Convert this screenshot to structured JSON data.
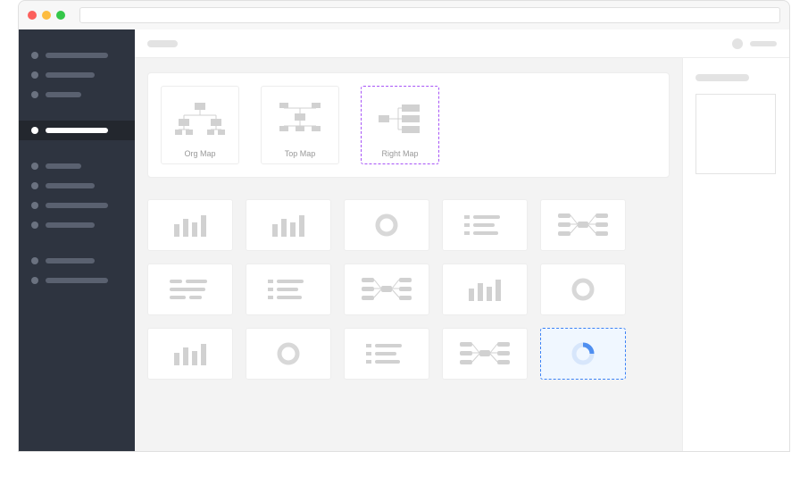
{
  "maps": [
    {
      "label": "Org  Map",
      "selected": false,
      "kind": "org"
    },
    {
      "label": "Top Map",
      "selected": false,
      "kind": "top"
    },
    {
      "label": "Right Map",
      "selected": true,
      "kind": "right"
    }
  ],
  "grid": [
    {
      "kind": "bar",
      "selected": false
    },
    {
      "kind": "bar",
      "selected": false
    },
    {
      "kind": "donut",
      "selected": false
    },
    {
      "kind": "list",
      "selected": false
    },
    {
      "kind": "mind",
      "selected": false
    },
    {
      "kind": "text",
      "selected": false
    },
    {
      "kind": "list",
      "selected": false
    },
    {
      "kind": "mind",
      "selected": false
    },
    {
      "kind": "bar",
      "selected": false
    },
    {
      "kind": "donut",
      "selected": false
    },
    {
      "kind": "bar",
      "selected": false
    },
    {
      "kind": "donut",
      "selected": false
    },
    {
      "kind": "list",
      "selected": false
    },
    {
      "kind": "mind",
      "selected": false
    },
    {
      "kind": "donut-blue",
      "selected": true
    }
  ],
  "sidebar": {
    "groups": [
      [
        {
          "len": "long",
          "active": false
        },
        {
          "len": "med",
          "active": false
        },
        {
          "len": "short",
          "active": false
        }
      ],
      [
        {
          "len": "long",
          "active": true
        }
      ],
      [
        {
          "len": "short",
          "active": false
        },
        {
          "len": "med",
          "active": false
        },
        {
          "len": "long",
          "active": false
        },
        {
          "len": "med",
          "active": false
        }
      ],
      [
        {
          "len": "med",
          "active": false
        },
        {
          "len": "long",
          "active": false
        }
      ]
    ]
  }
}
